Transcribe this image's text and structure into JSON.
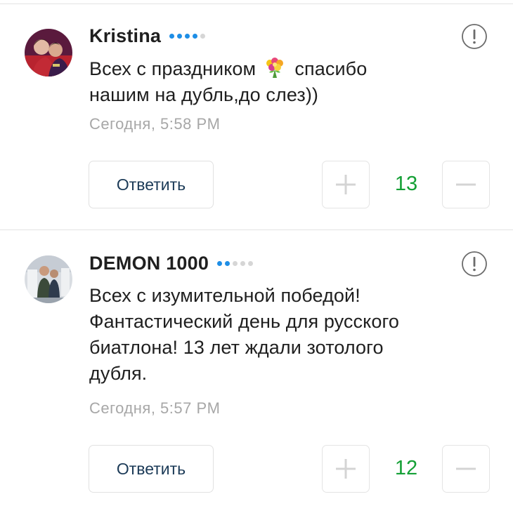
{
  "accent_blue": "#1e8ee6",
  "vote_green": "#15a036",
  "comments": [
    {
      "author": "Kristina",
      "rating_dots": {
        "filled": 4,
        "total": 5
      },
      "text_before_icon": "Всех с праздником ",
      "inline_icon": "flower-bouquet-icon",
      "text_after_icon": " спасибо\nнашим на дубль,до слез))",
      "timestamp": "Сегодня, 5:58 PM",
      "reply_label": "Ответить",
      "votes": "13"
    },
    {
      "author": "DEMON 1000",
      "rating_dots": {
        "filled": 2,
        "total": 5
      },
      "text": "Всех с изумительной победой!\nФантастический день для русского\nбиатлона! 13 лет ждали зотолого\nдубля.",
      "timestamp": "Сегодня, 5:57 PM",
      "reply_label": "Ответить",
      "votes": "12"
    }
  ]
}
